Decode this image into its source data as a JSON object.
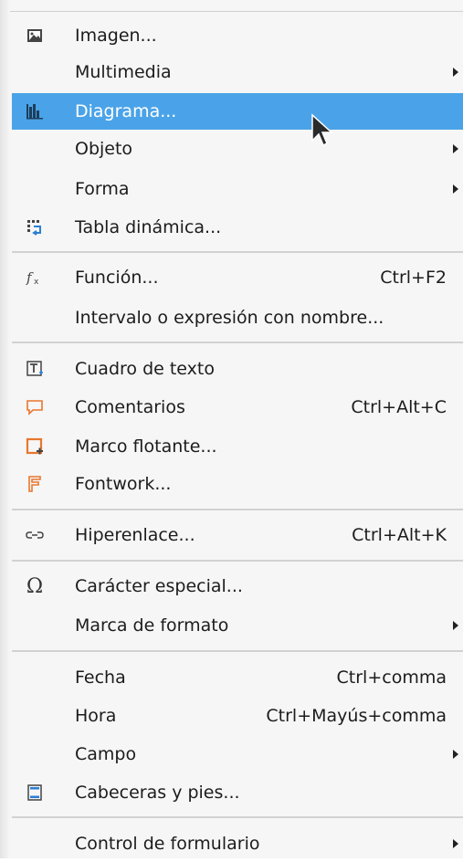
{
  "menu": {
    "items": [
      {
        "label": "Imagen...",
        "icon": "image-icon"
      },
      {
        "label": "Multimedia",
        "submenu": true
      },
      {
        "label": "Diagrama...",
        "icon": "chart-icon",
        "highlighted": true
      },
      {
        "label": "Objeto",
        "submenu": true
      },
      {
        "label": "Forma",
        "submenu": true
      },
      {
        "label": "Tabla dinámica...",
        "icon": "pivot-table-icon"
      },
      {
        "label": "Función...",
        "shortcut": "Ctrl+F2",
        "icon": "function-icon"
      },
      {
        "label": "Intervalo o expresión con nombre..."
      },
      {
        "label": "Cuadro de texto",
        "icon": "text-box-icon"
      },
      {
        "label": "Comentarios",
        "shortcut": "Ctrl+Alt+C",
        "icon": "comment-icon"
      },
      {
        "label": "Marco flotante...",
        "icon": "floating-frame-icon"
      },
      {
        "label": "Fontwork...",
        "icon": "fontwork-icon"
      },
      {
        "label": "Hiperenlace...",
        "shortcut": "Ctrl+Alt+K",
        "icon": "hyperlink-icon"
      },
      {
        "label": "Carácter especial...",
        "icon": "omega-icon"
      },
      {
        "label": "Marca de formato",
        "submenu": true
      },
      {
        "label": "Fecha",
        "shortcut": "Ctrl+comma"
      },
      {
        "label": "Hora",
        "shortcut": "Ctrl+Mayús+comma"
      },
      {
        "label": "Campo",
        "submenu": true
      },
      {
        "label": "Cabeceras y pies...",
        "icon": "header-footer-icon"
      },
      {
        "label": "Control de formulario",
        "submenu": true
      }
    ]
  },
  "colors": {
    "highlight": "#4aa3e8",
    "accent_orange": "#e8772e"
  }
}
